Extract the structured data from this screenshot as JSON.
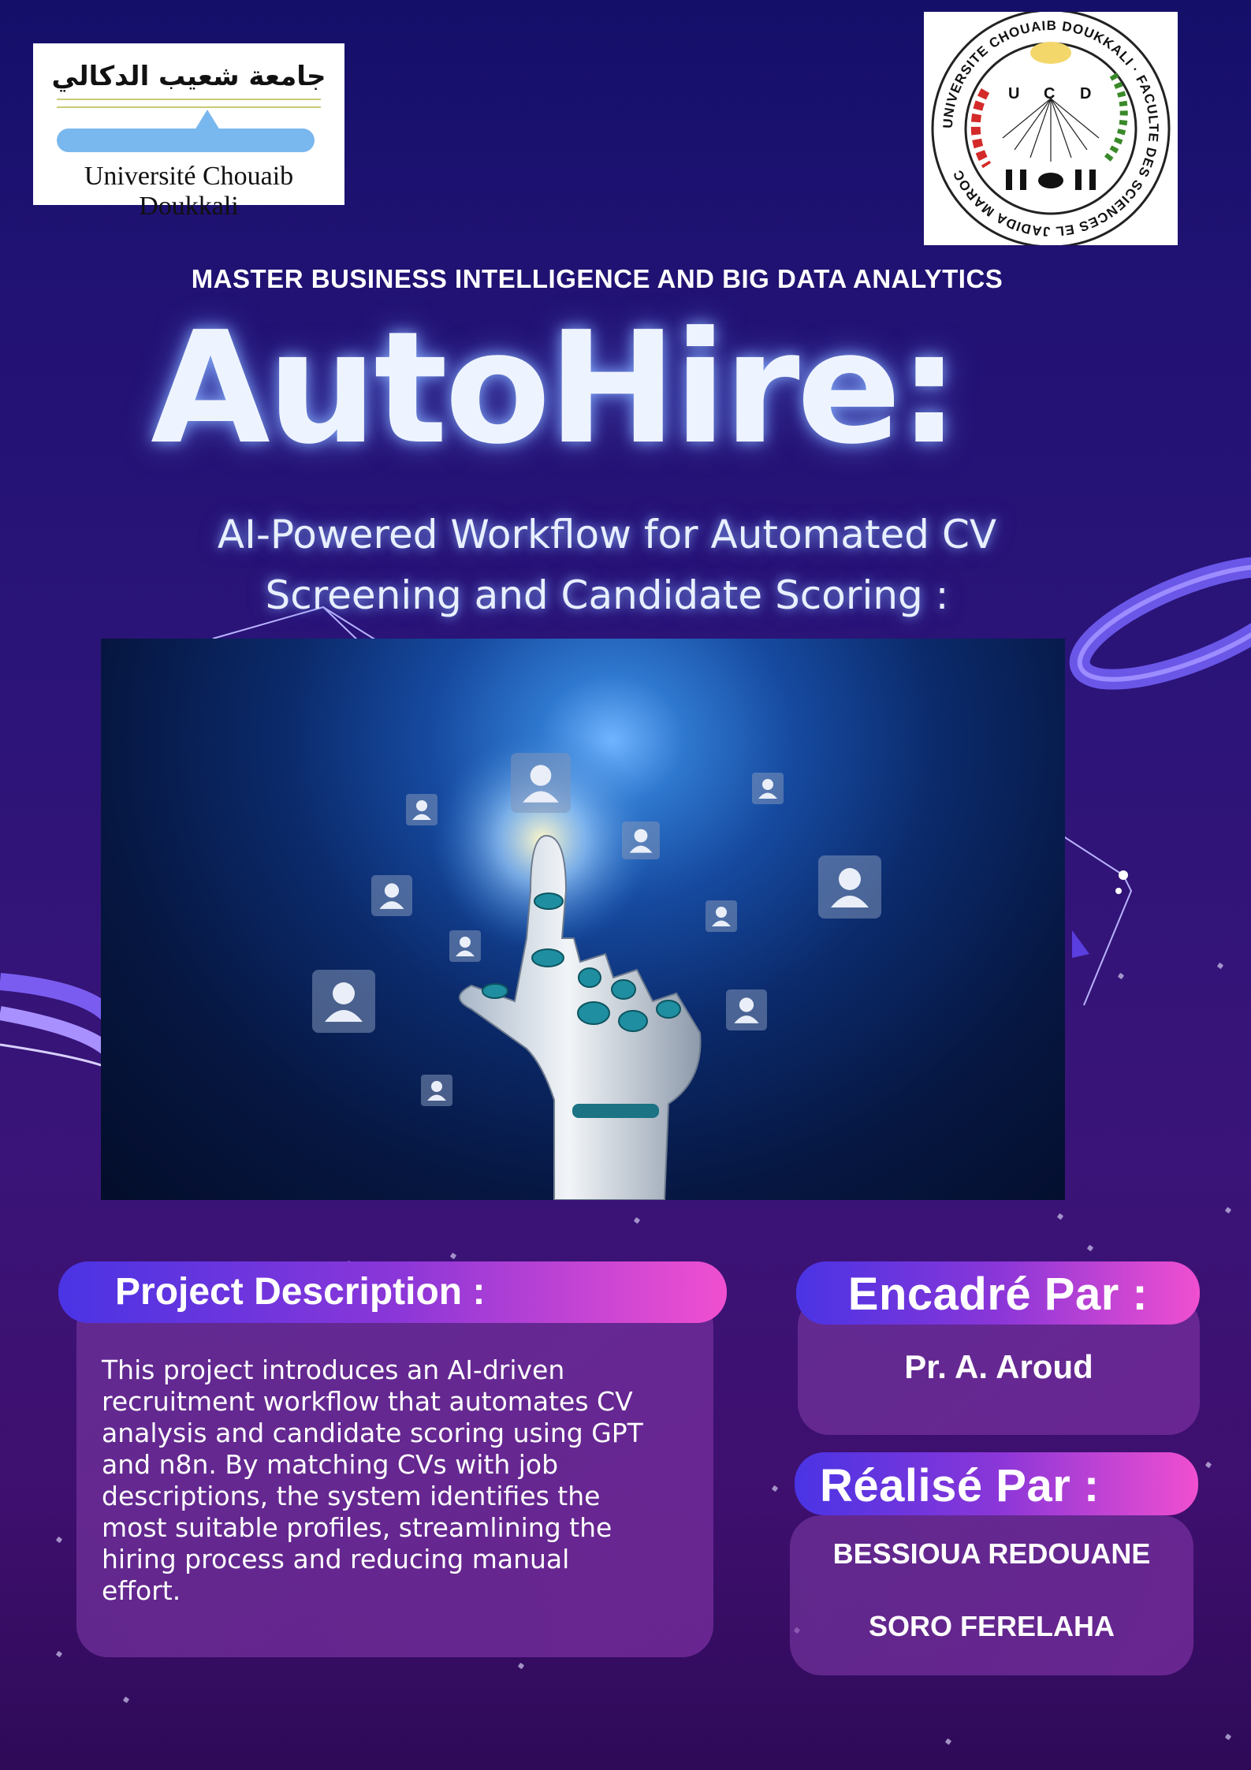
{
  "logos": {
    "left_arabic": "جامعة شعيب الدكالي",
    "left_latin": "Université Chouaib Doukkali",
    "right_seal_text": "UNIVERSITE CHOUAIB DOUKKALI · FACULTE DES SCIENCES EL JADIDA MAROC",
    "right_seal_letters": [
      "U",
      "C",
      "D"
    ]
  },
  "program": "MASTER BUSINESS INTELLIGENCE AND BIG DATA ANALYTICS",
  "title": "AutoHire:",
  "subtitle_line1": "AI-Powered Workflow for Automated CV",
  "subtitle_line2": "Screening and Candidate Scoring :",
  "description": {
    "heading": "Project Description :",
    "lines": [
      "This project introduces an AI-driven",
      "recruitment workflow that automates CV",
      "analysis and candidate scoring using GPT",
      "and n8n. By matching CVs with job",
      "descriptions, the system identifies the",
      "most suitable profiles, streamlining the",
      "hiring process and reducing manual",
      "effort."
    ]
  },
  "supervisor": {
    "heading": "Encadré Par :",
    "name": "Pr. A. Aroud"
  },
  "authors": {
    "heading": "Réalisé Par :",
    "names": [
      "BESSIOUA REDOUANE",
      "SORO FERELAHA"
    ]
  },
  "colors": {
    "background_top": "#14106a",
    "background_bottom": "#2e0a58",
    "pill_start": "#4a34e4",
    "pill_end": "#f04fd0",
    "glow": "#8cb4ff"
  },
  "icons": [
    "robot-hand-icon",
    "person-profile-icon"
  ]
}
